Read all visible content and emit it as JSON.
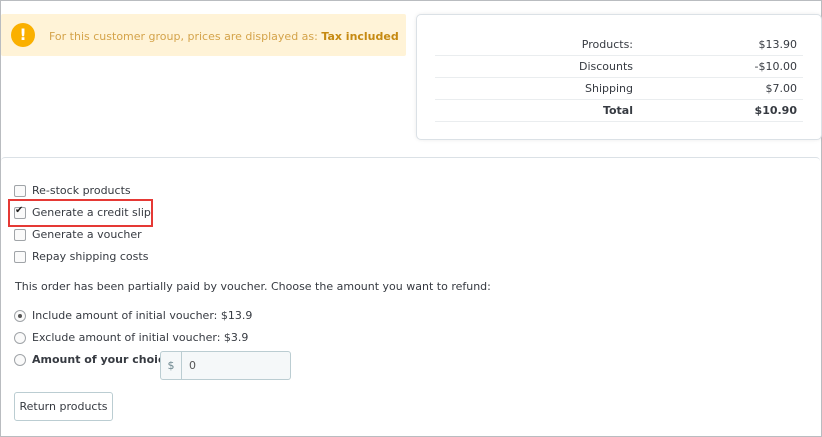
{
  "alert": {
    "text": "For this customer group, prices are displayed as: ",
    "bold": "Tax included"
  },
  "totals": [
    {
      "label": "Products:",
      "value": "$13.90"
    },
    {
      "label": "Discounts",
      "value": "-$10.00"
    },
    {
      "label": "Shipping",
      "value": "$7.00"
    },
    {
      "label": "Total",
      "value": "$10.90"
    }
  ],
  "options": {
    "restock": {
      "label": "Re-stock products",
      "checked": false
    },
    "credit_slip": {
      "label": "Generate a credit slip",
      "checked": true
    },
    "voucher": {
      "label": "Generate a voucher",
      "checked": false
    },
    "repay_shipping": {
      "label": "Repay shipping costs",
      "checked": false
    }
  },
  "info": "This order has been partially paid by voucher. Choose the amount you want to refund:",
  "refund": {
    "include": "Include amount of initial voucher: $13.9",
    "exclude": "Exclude amount of initial voucher: $3.9",
    "choice": "Amount of your choice:",
    "currency": "$",
    "amount": "0"
  },
  "button": "Return products"
}
